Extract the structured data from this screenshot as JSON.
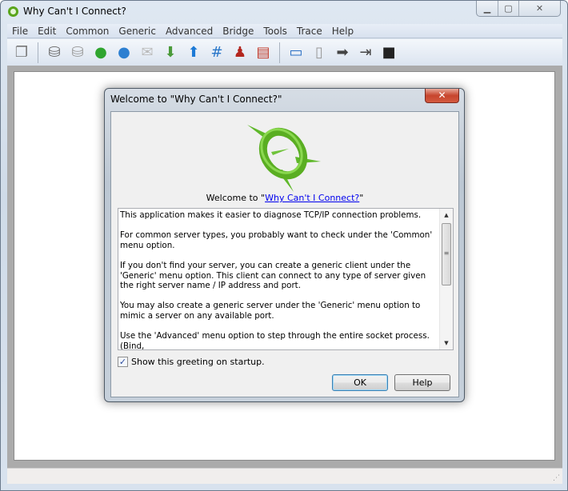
{
  "window": {
    "title": "Why Can't I Connect?",
    "controls": {
      "minimize": "▁",
      "maximize": "▢",
      "close": "✕"
    }
  },
  "menu": [
    "File",
    "Edit",
    "Common",
    "Generic",
    "Advanced",
    "Bridge",
    "Tools",
    "Trace",
    "Help"
  ],
  "toolbar": [
    {
      "icon": "windows-icon",
      "glyph": "❐",
      "color": "#777"
    },
    {
      "sep": true
    },
    {
      "icon": "database-help-icon",
      "glyph": "⛁",
      "color": "#666"
    },
    {
      "icon": "database-help-small-icon",
      "glyph": "⛁",
      "color": "#999"
    },
    {
      "icon": "green-globe-icon",
      "glyph": "●",
      "color": "#2fa52f"
    },
    {
      "icon": "blue-globe-network-icon",
      "glyph": "●",
      "color": "#2c7fd1"
    },
    {
      "icon": "mail-icon",
      "glyph": "✉",
      "color": "#bbb"
    },
    {
      "icon": "download-icon",
      "glyph": "⬇",
      "color": "#4a9a3a"
    },
    {
      "icon": "send-mail-icon",
      "glyph": "⬆",
      "color": "#1d7ad6"
    },
    {
      "icon": "hash-add-icon",
      "glyph": "#",
      "color": "#2a77c9"
    },
    {
      "icon": "users-add-icon",
      "glyph": "♟",
      "color": "#b3261e"
    },
    {
      "icon": "books-icon",
      "glyph": "▤",
      "color": "#c23a2a"
    },
    {
      "sep": true
    },
    {
      "icon": "computer-network-icon",
      "glyph": "▭",
      "color": "#2a6fc4"
    },
    {
      "icon": "server-network-icon",
      "glyph": "▯",
      "color": "#999"
    },
    {
      "icon": "step-arrow-icon",
      "glyph": "➡",
      "color": "#444"
    },
    {
      "icon": "step-end-icon",
      "glyph": "⇥",
      "color": "#444"
    },
    {
      "icon": "stop-icon",
      "glyph": "■",
      "color": "#222"
    }
  ],
  "dialog": {
    "title": "Welcome to \"Why Can't I Connect?\"",
    "close": "✕",
    "welcome_prefix": "Welcome to \"",
    "welcome_link": "Why Can't I Connect?",
    "welcome_suffix": "\"",
    "paragraphs": [
      "This application makes it easier to diagnose TCP/IP connection problems.",
      "For common server types, you probably want to check under the 'Common' menu option.",
      "If you don't find your server, you can create a generic client under the 'Generic' menu option.  This client can connect to any type of server given the right server name / IP address and port.",
      "You may also create a generic server under the 'Generic' menu option to mimic a server on any available port.",
      "Use the 'Advanced' menu option to step through the entire socket process. (Bind,"
    ],
    "show_greeting_label": "Show this greeting on startup.",
    "show_greeting_checked": true,
    "ok_label": "OK",
    "help_label": "Help"
  }
}
